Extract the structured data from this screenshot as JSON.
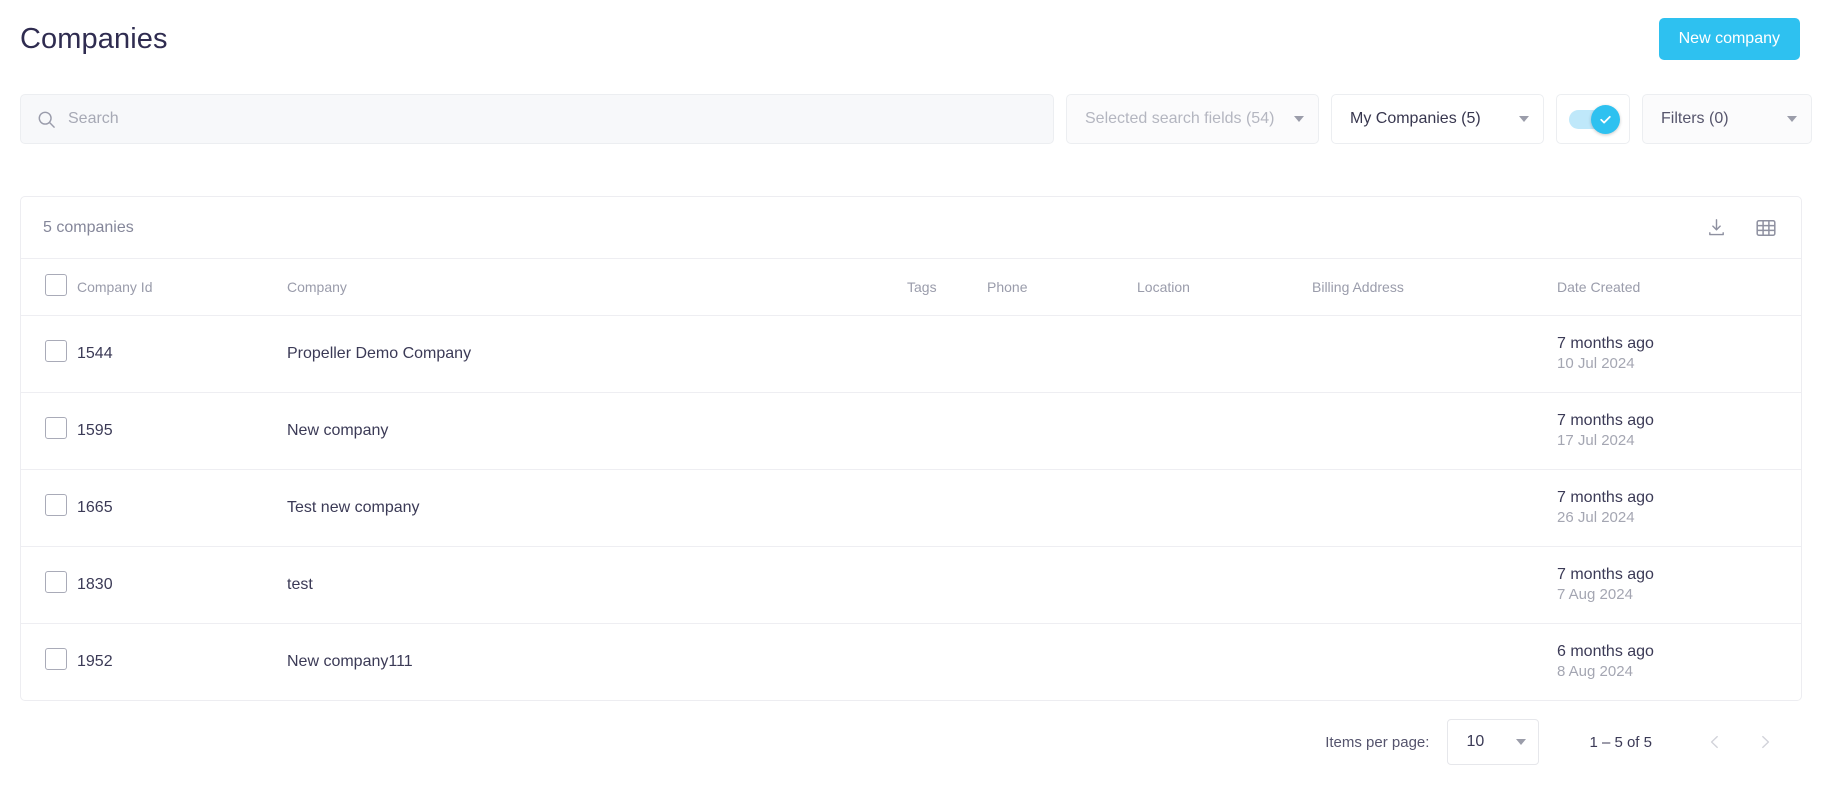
{
  "header": {
    "title": "Companies",
    "new_company_label": "New company"
  },
  "toolbar": {
    "search_placeholder": "Search",
    "search_value": "",
    "search_fields_label": "Selected search fields (54)",
    "my_companies_label": "My Companies (5)",
    "toggle_on": true,
    "filters_label": "Filters (0)"
  },
  "card": {
    "count_label": "5 companies",
    "download_icon": "download-icon",
    "columns_icon": "grid-columns-icon"
  },
  "table": {
    "columns": [
      "Company Id",
      "Company",
      "Tags",
      "Phone",
      "Location",
      "Billing Address",
      "Date Created"
    ],
    "rows": [
      {
        "id": "1544",
        "company": "Propeller Demo Company",
        "tags": "",
        "phone": "",
        "location": "",
        "billing_address": "",
        "date_relative": "7 months ago",
        "date_absolute": "10 Jul 2024"
      },
      {
        "id": "1595",
        "company": "New company",
        "tags": "",
        "phone": "",
        "location": "",
        "billing_address": "",
        "date_relative": "7 months ago",
        "date_absolute": "17 Jul 2024"
      },
      {
        "id": "1665",
        "company": "Test new company",
        "tags": "",
        "phone": "",
        "location": "",
        "billing_address": "",
        "date_relative": "7 months ago",
        "date_absolute": "26 Jul 2024"
      },
      {
        "id": "1830",
        "company": "test",
        "tags": "",
        "phone": "",
        "location": "",
        "billing_address": "",
        "date_relative": "7 months ago",
        "date_absolute": "7 Aug 2024"
      },
      {
        "id": "1952",
        "company": "New company111",
        "tags": "",
        "phone": "",
        "location": "",
        "billing_address": "",
        "date_relative": "6 months ago",
        "date_absolute": "8 Aug 2024"
      }
    ]
  },
  "pagination": {
    "items_per_page_label": "Items per page:",
    "items_per_page_value": "10",
    "range_label": "1 – 5 of 5",
    "prev_enabled": false,
    "next_enabled": false
  },
  "colors": {
    "accent": "#2ec1f0",
    "text_primary": "#3b3a56",
    "text_muted": "#9a9cab",
    "border": "#eeeef2"
  }
}
